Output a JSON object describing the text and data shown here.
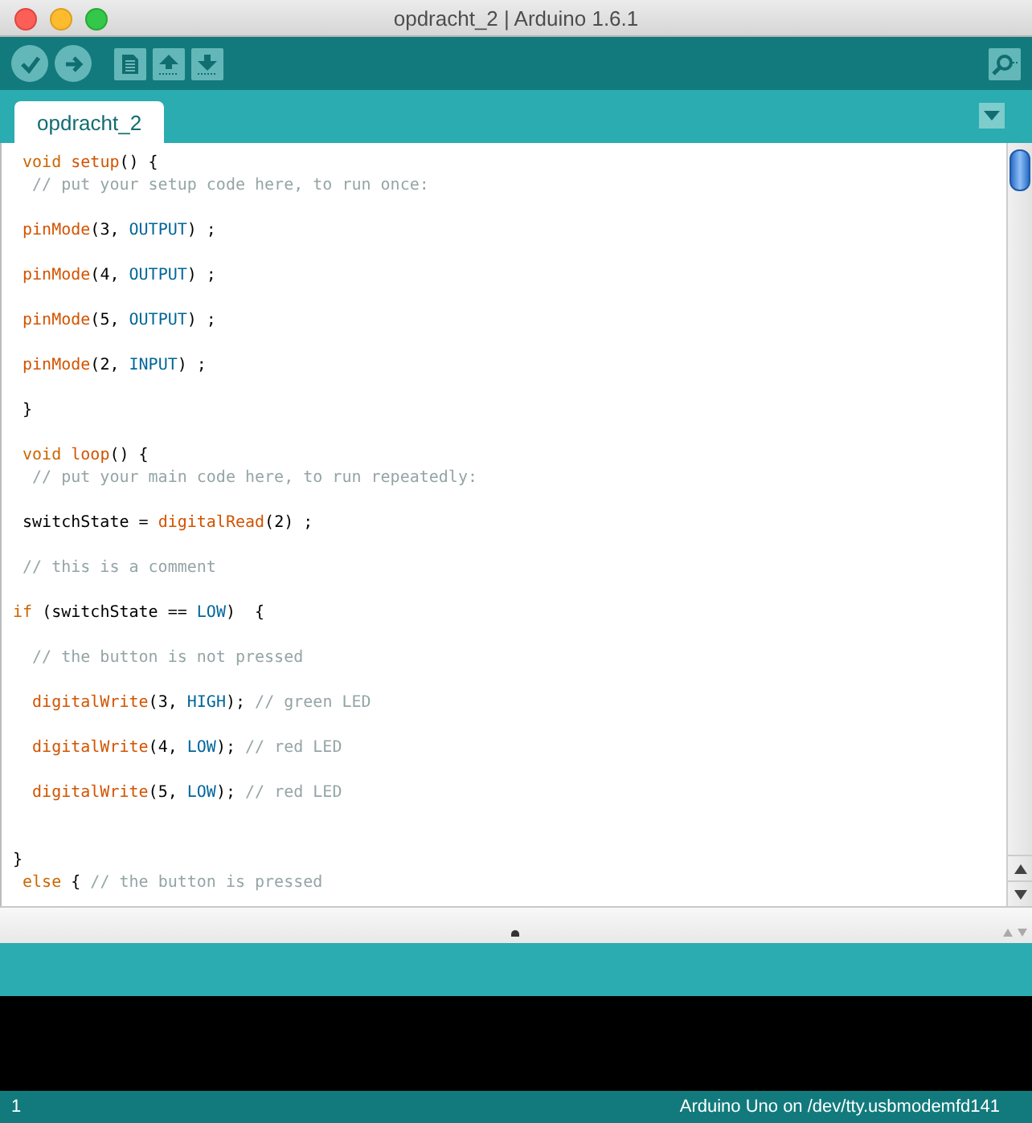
{
  "window": {
    "title": "opdracht_2 | Arduino 1.6.1"
  },
  "toolbar": {
    "buttons": [
      {
        "kind": "verify"
      },
      {
        "kind": "upload"
      },
      {
        "kind": "new"
      },
      {
        "kind": "open"
      },
      {
        "kind": "save"
      }
    ]
  },
  "tabs": [
    {
      "label": "opdracht_2",
      "selected": true
    }
  ],
  "editor": {
    "lines": [
      {
        "kind": "code",
        "tokens": [
          {
            "t": " void",
            "kind": "keyword"
          },
          {
            "t": " setup",
            "kind": "function"
          },
          {
            "t": "() {",
            "kind": "plain"
          }
        ]
      },
      {
        "kind": "code",
        "tokens": [
          {
            "t": "  // put your setup code here, to run once:",
            "kind": "comment"
          }
        ]
      },
      {
        "kind": "blank"
      },
      {
        "kind": "code",
        "tokens": [
          {
            "t": " pinMode",
            "kind": "function"
          },
          {
            "t": "(3, ",
            "kind": "plain"
          },
          {
            "t": "OUTPUT",
            "kind": "constant"
          },
          {
            "t": ") ;",
            "kind": "plain"
          }
        ]
      },
      {
        "kind": "blank"
      },
      {
        "kind": "code",
        "tokens": [
          {
            "t": " pinMode",
            "kind": "function"
          },
          {
            "t": "(4, ",
            "kind": "plain"
          },
          {
            "t": "OUTPUT",
            "kind": "constant"
          },
          {
            "t": ") ;",
            "kind": "plain"
          }
        ]
      },
      {
        "kind": "blank"
      },
      {
        "kind": "code",
        "tokens": [
          {
            "t": " pinMode",
            "kind": "function"
          },
          {
            "t": "(5, ",
            "kind": "plain"
          },
          {
            "t": "OUTPUT",
            "kind": "constant"
          },
          {
            "t": ") ;",
            "kind": "plain"
          }
        ]
      },
      {
        "kind": "blank"
      },
      {
        "kind": "code",
        "tokens": [
          {
            "t": " pinMode",
            "kind": "function"
          },
          {
            "t": "(2, ",
            "kind": "plain"
          },
          {
            "t": "INPUT",
            "kind": "constant"
          },
          {
            "t": ") ;",
            "kind": "plain"
          }
        ]
      },
      {
        "kind": "blank"
      },
      {
        "kind": "code",
        "tokens": [
          {
            "t": " }",
            "kind": "plain"
          }
        ]
      },
      {
        "kind": "blank"
      },
      {
        "kind": "code",
        "tokens": [
          {
            "t": " void",
            "kind": "keyword"
          },
          {
            "t": " loop",
            "kind": "function"
          },
          {
            "t": "() {",
            "kind": "plain"
          }
        ]
      },
      {
        "kind": "code",
        "tokens": [
          {
            "t": "  // put your main code here, to run repeatedly:",
            "kind": "comment"
          }
        ]
      },
      {
        "kind": "blank"
      },
      {
        "kind": "code",
        "tokens": [
          {
            "t": " switchState = ",
            "kind": "plain"
          },
          {
            "t": "digitalRead",
            "kind": "function"
          },
          {
            "t": "(2) ;",
            "kind": "plain"
          }
        ]
      },
      {
        "kind": "blank"
      },
      {
        "kind": "code",
        "tokens": [
          {
            "t": " // this is a comment",
            "kind": "comment"
          }
        ]
      },
      {
        "kind": "blank"
      },
      {
        "kind": "code",
        "tokens": [
          {
            "t": "if",
            "kind": "keyword"
          },
          {
            "t": " (switchState == ",
            "kind": "plain"
          },
          {
            "t": "LOW",
            "kind": "constant"
          },
          {
            "t": ")  {",
            "kind": "plain"
          }
        ]
      },
      {
        "kind": "blank"
      },
      {
        "kind": "code",
        "tokens": [
          {
            "t": "  // the button is not pressed",
            "kind": "comment"
          }
        ]
      },
      {
        "kind": "blank"
      },
      {
        "kind": "code",
        "tokens": [
          {
            "t": "  digitalWrite",
            "kind": "function"
          },
          {
            "t": "(3, ",
            "kind": "plain"
          },
          {
            "t": "HIGH",
            "kind": "constant"
          },
          {
            "t": "); ",
            "kind": "plain"
          },
          {
            "t": "// green LED",
            "kind": "comment"
          }
        ]
      },
      {
        "kind": "blank"
      },
      {
        "kind": "code",
        "tokens": [
          {
            "t": "  digitalWrite",
            "kind": "function"
          },
          {
            "t": "(4, ",
            "kind": "plain"
          },
          {
            "t": "LOW",
            "kind": "constant"
          },
          {
            "t": "); ",
            "kind": "plain"
          },
          {
            "t": "// red LED",
            "kind": "comment"
          }
        ]
      },
      {
        "kind": "blank"
      },
      {
        "kind": "code",
        "tokens": [
          {
            "t": "  digitalWrite",
            "kind": "function"
          },
          {
            "t": "(5, ",
            "kind": "plain"
          },
          {
            "t": "LOW",
            "kind": "constant"
          },
          {
            "t": "); ",
            "kind": "plain"
          },
          {
            "t": "// red LED",
            "kind": "comment"
          }
        ]
      },
      {
        "kind": "blank"
      },
      {
        "kind": "blank"
      },
      {
        "kind": "code",
        "tokens": [
          {
            "t": "}",
            "kind": "plain"
          }
        ]
      },
      {
        "kind": "code",
        "tokens": [
          {
            "t": " else",
            "kind": "keyword"
          },
          {
            "t": " { ",
            "kind": "plain"
          },
          {
            "t": "// the button is pressed",
            "kind": "comment"
          }
        ]
      }
    ]
  },
  "status_bar": {
    "line": "1",
    "board": "Arduino Uno on /dev/tty.usbmodemfd141"
  }
}
